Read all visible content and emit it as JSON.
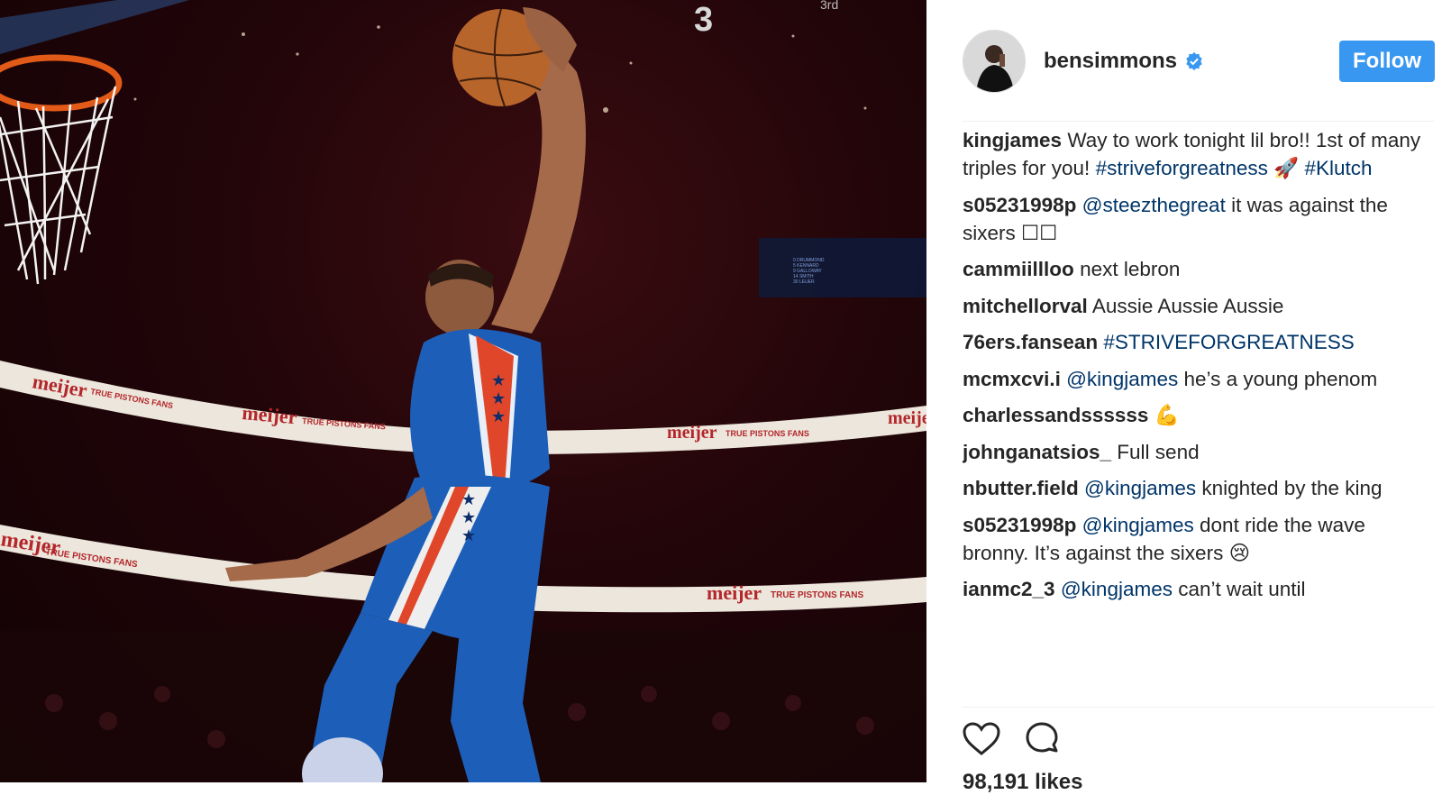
{
  "post": {
    "username": "bensimmons",
    "follow_label": "Follow",
    "likes_text": "98,191 likes"
  },
  "photo": {
    "jersey_number": "3",
    "scoreboard_period": "3rd",
    "banner_brand": "meijer",
    "banner_slogan": "TRUE PISTONS FANS",
    "scoreboard_names": [
      "0 DRUMMOND",
      "5 KENNARD",
      "9 GALLOWAY",
      "14 SMITH",
      "30 LEUER"
    ]
  },
  "comments": [
    {
      "user": "kingjames",
      "parts": [
        {
          "t": "Way to work tonight lil bro!! 1st of many triples for you! "
        },
        {
          "t": "#striveforgreatness",
          "link": true
        },
        {
          "t": " 🚀 "
        },
        {
          "t": "#Klutch",
          "link": true
        }
      ]
    },
    {
      "user": "s05231998p",
      "parts": [
        {
          "t": "@steezthegreat",
          "link": true
        },
        {
          "t": " it was against the sixers ☐☐"
        }
      ]
    },
    {
      "user": "cammiillloo",
      "parts": [
        {
          "t": "next lebron"
        }
      ]
    },
    {
      "user": "mitchellorval",
      "parts": [
        {
          "t": "Aussie Aussie Aussie"
        }
      ]
    },
    {
      "user": "76ers.fansean",
      "parts": [
        {
          "t": "#STRIVEFORGREATNESS",
          "link": true
        }
      ]
    },
    {
      "user": "mcmxcvi.i",
      "parts": [
        {
          "t": "@kingjames",
          "link": true
        },
        {
          "t": " he’s a young phenom"
        }
      ]
    },
    {
      "user": "charlessandssssss",
      "parts": [
        {
          "t": "💪"
        }
      ]
    },
    {
      "user": "johnganatsios_",
      "parts": [
        {
          "t": "Full send"
        }
      ]
    },
    {
      "user": "nbutter.field",
      "parts": [
        {
          "t": "@kingjames",
          "link": true
        },
        {
          "t": " knighted by the king"
        }
      ]
    },
    {
      "user": "s05231998p",
      "parts": [
        {
          "t": "@kingjames",
          "link": true
        },
        {
          "t": " dont ride the wave bronny. It’s against the sixers 😢"
        }
      ]
    },
    {
      "user": "ianmc2_3",
      "parts": [
        {
          "t": "@kingjames",
          "link": true
        },
        {
          "t": " can’t wait until"
        }
      ]
    }
  ],
  "colors": {
    "follow_bg": "#3897f0",
    "link": "#003569",
    "verified": "#3897f0",
    "jersey_blue": "#1d5fb8"
  },
  "icons": {
    "verified": "verified-badge-icon",
    "like": "heart-icon",
    "comment": "comment-bubble-icon"
  }
}
